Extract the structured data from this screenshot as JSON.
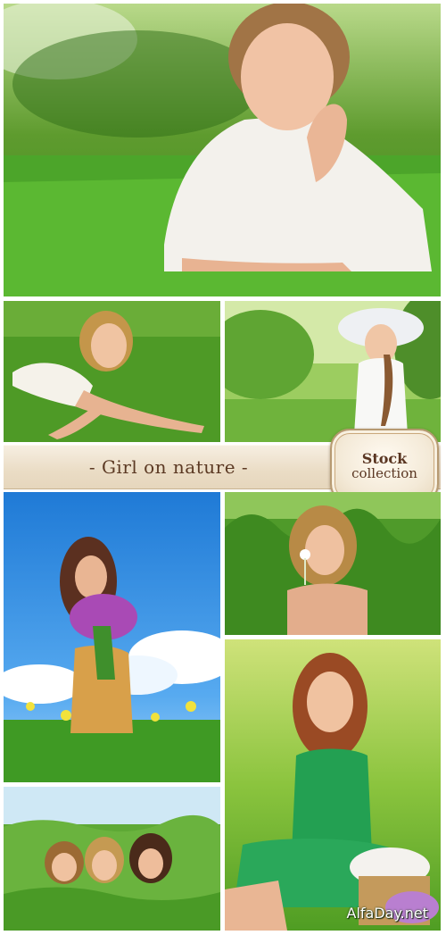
{
  "banner": {
    "title": "- Girl on nature -",
    "badge_line1": "Stock",
    "badge_line2": "collection"
  },
  "watermark": "AlfaDay.net",
  "colors": {
    "grass": "#5fa83a",
    "sky": "#3f8fe0",
    "banner_bg": "#eadcc5",
    "banner_text": "#5c3a24"
  }
}
